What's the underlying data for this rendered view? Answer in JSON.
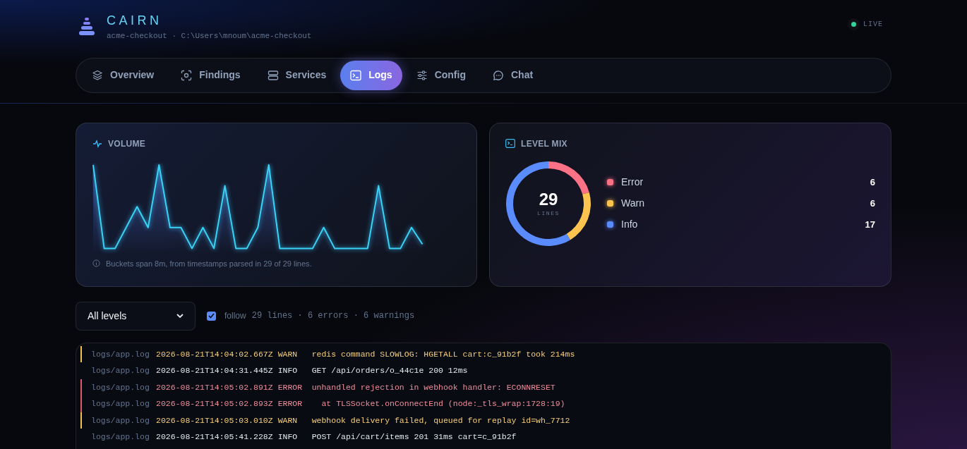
{
  "app": {
    "title": "CAIRN",
    "subtitle": "acme-checkout · C:\\Users\\mnoum\\acme-checkout",
    "status": "LIVE"
  },
  "tabs": [
    {
      "label": "Overview",
      "selected": false
    },
    {
      "label": "Findings",
      "selected": false
    },
    {
      "label": "Services",
      "selected": false
    },
    {
      "label": "Logs",
      "selected": true
    },
    {
      "label": "Config",
      "selected": false
    },
    {
      "label": "Chat",
      "selected": false
    }
  ],
  "volume": {
    "title": "VOLUME",
    "note": "Buckets span 8m, from timestamps parsed in 29 of 29 lines."
  },
  "level_mix": {
    "title": "LEVEL MIX",
    "total": "29",
    "total_label": "LINES",
    "chart_data": {
      "type": "donut",
      "categories": [
        "Error",
        "Warn",
        "Info"
      ],
      "values": [
        20.69,
        20.69,
        58.62
      ]
    },
    "legend": [
      {
        "count": "6",
        "color": "#fb7185"
      },
      {
        "count": "6",
        "color": "#fcc44f"
      },
      {
        "count": "17",
        "color": "#5b8cff"
      }
    ]
  },
  "filter": {
    "value": "All levels",
    "follow": {
      "label": "follow",
      "checked": true
    },
    "summary": "29 lines · 6 errors · 6 warnings"
  },
  "log_rows": [
    {
      "file": "logs/app.log",
      "timestamp": "2026-08-21T14:04:02.667Z",
      "level": "WARN",
      "message": "redis command SLOWLOG: HGETALL cart:c_91b2f took 214ms"
    },
    {
      "file": "logs/app.log",
      "timestamp": "2026-08-21T14:04:31.445Z",
      "level": "INFO",
      "message": "GET /api/orders/o_44c1e 200 12ms"
    },
    {
      "file": "logs/app.log",
      "timestamp": "2026-08-21T14:05:02.891Z",
      "level": "ERROR",
      "message": "unhandled rejection in webhook handler: ECONNRESET"
    },
    {
      "file": "logs/app.log",
      "timestamp": "2026-08-21T14:05:02.893Z",
      "level": "ERROR",
      "message": "  at TLSSocket.onConnectEnd (node:_tls_wrap:1728:19)"
    },
    {
      "file": "logs/app.log",
      "timestamp": "2026-08-21T14:05:03.010Z",
      "level": "WARN",
      "message": "webhook delivery failed, queued for replay id=wh_7712"
    },
    {
      "file": "logs/app.log",
      "timestamp": "2026-08-21T14:05:41.228Z",
      "level": "INFO",
      "message": "POST /api/cart/items 201 31ms cart=c_91b2f"
    }
  ]
}
